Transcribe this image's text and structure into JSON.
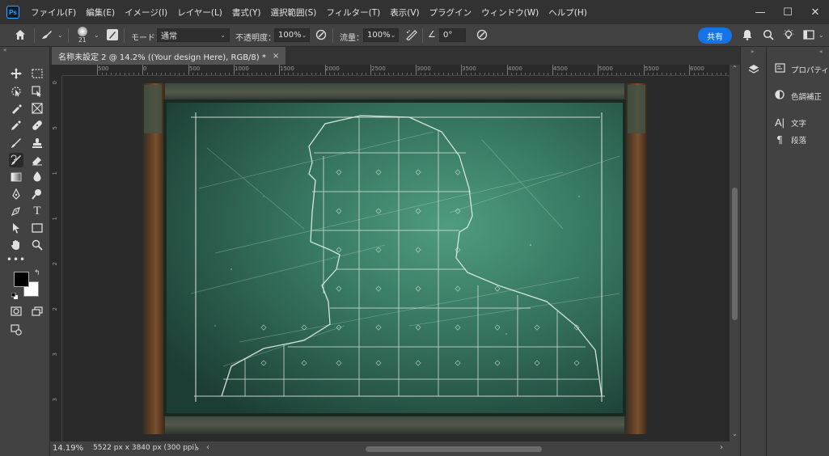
{
  "app": {
    "logo": "Ps"
  },
  "menu": [
    "ファイル(F)",
    "編集(E)",
    "イメージ(I)",
    "レイヤー(L)",
    "書式(Y)",
    "選択範囲(S)",
    "フィルター(T)",
    "表示(V)",
    "プラグイン",
    "ウィンドウ(W)",
    "ヘルプ(H)"
  ],
  "window": {
    "minimize": "—",
    "maximize": "☐",
    "close": "✕"
  },
  "options": {
    "brush_size": "21",
    "mode_label": "モード：",
    "mode_value": "通常",
    "opacity_label": "不透明度：",
    "opacity_value": "100%",
    "flow_label": "流量：",
    "flow_value": "100%",
    "angle_value": "0°",
    "share_label": "共有"
  },
  "document": {
    "tab_title": "名称未設定 2 @ 14.2% ((Your design Here), RGB/8) *",
    "close": "×"
  },
  "ruler": {
    "h_labels": [
      "500",
      "0",
      "500",
      "1000",
      "1500",
      "2000",
      "2500",
      "3000",
      "3500",
      "4000",
      "4500",
      "5000",
      "5500",
      "6000"
    ],
    "v_labels": [
      "0",
      "5",
      "1",
      "1",
      "2",
      "2",
      "3",
      "3"
    ]
  },
  "status": {
    "zoom": "14.19%",
    "doc_info": "5522 px x 3840 px (300 ppi)",
    "arrow": "›"
  },
  "panels": [
    {
      "icon": "properties-icon",
      "label": "プロパティ"
    },
    {
      "icon": "adjustments-icon",
      "label": "色調補正"
    },
    {
      "icon": "character-icon",
      "label": "文字"
    },
    {
      "icon": "paragraph-icon",
      "label": "段落"
    }
  ],
  "colors": {
    "accent": "#1473e6",
    "chalkboard": "#2f6b55",
    "frame": "#6b4a2e"
  }
}
